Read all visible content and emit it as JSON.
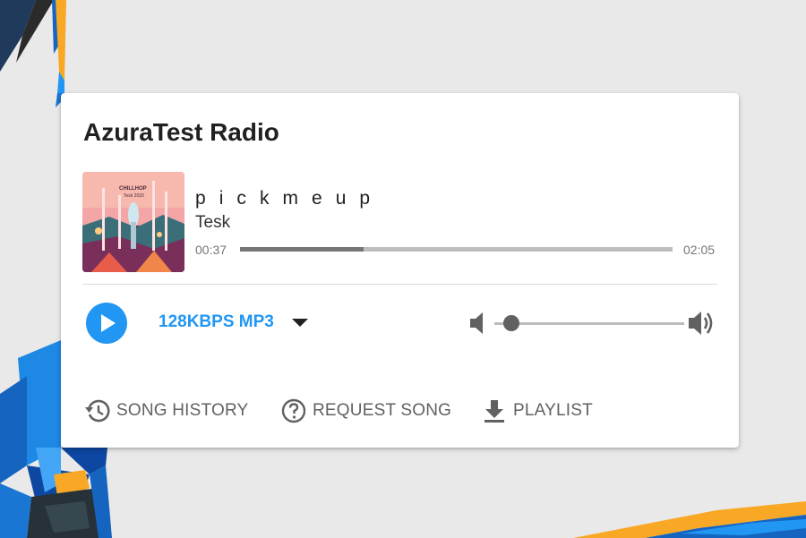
{
  "station": {
    "title": "AzuraTest Radio"
  },
  "now_playing": {
    "title": "pickmeup",
    "title_spaced": "p i c k m e u p",
    "artist": "Tesk",
    "elapsed": "00:37",
    "duration": "02:05",
    "progress_fraction": 0.285,
    "album_art_text": [
      "CHILLHOP",
      "Tesk 2020"
    ]
  },
  "controls": {
    "play_icon": "play-icon",
    "stream_label": "128KBPS MP3",
    "stream_caret_icon": "chevron-down-icon",
    "volume_fraction": 0.06,
    "mute_icon": "volume-mute-icon",
    "max_icon": "volume-max-icon"
  },
  "actions": [
    {
      "label": "SONG HISTORY",
      "icon": "history-icon"
    },
    {
      "label": "REQUEST SONG",
      "icon": "help-circle-icon"
    },
    {
      "label": "PLAYLIST",
      "icon": "download-icon"
    }
  ],
  "colors": {
    "accent": "#2196f3",
    "background": "#e9e9ea",
    "card": "#ffffff",
    "text": "#212121",
    "muted": "#616161"
  }
}
